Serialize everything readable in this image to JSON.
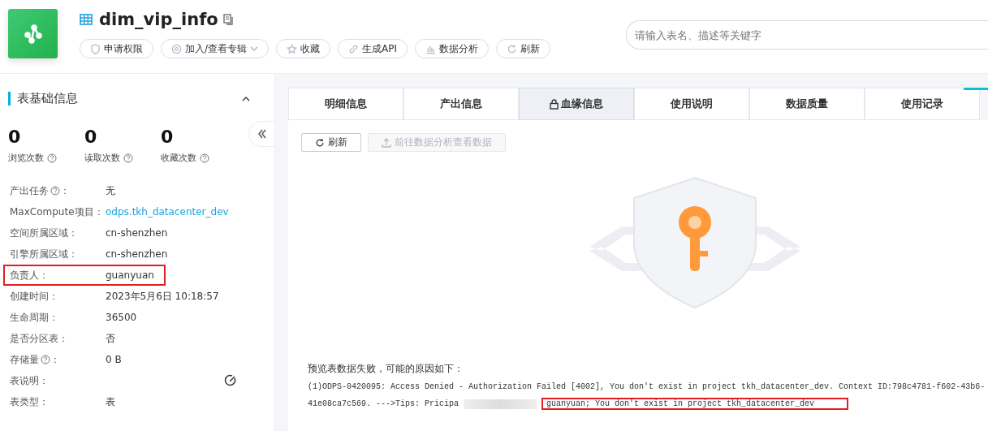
{
  "header": {
    "title": "dim_vip_info",
    "actions": [
      {
        "kind": "shield",
        "label": "申请权限",
        "caret": false
      },
      {
        "kind": "album",
        "label": "加入/查看专辑",
        "caret": true
      },
      {
        "kind": "star",
        "label": "收藏",
        "caret": false
      },
      {
        "kind": "link",
        "label": "生成API",
        "caret": false
      },
      {
        "kind": "chart",
        "label": "数据分析",
        "caret": false
      },
      {
        "kind": "refresh",
        "label": "刷新",
        "caret": false
      }
    ],
    "search": {
      "placeholder": "请输入表名、描述等关键字"
    }
  },
  "sidebar": {
    "title": "表基础信息",
    "colon": "：",
    "stats": [
      {
        "value": "0",
        "label": "浏览次数"
      },
      {
        "value": "0",
        "label": "读取次数"
      },
      {
        "value": "0",
        "label": "收藏次数"
      }
    ],
    "fields": [
      {
        "label": "产出任务",
        "help": true,
        "value": "无",
        "link": false,
        "highlighted": false
      },
      {
        "label": "MaxCompute项目",
        "help": false,
        "value": "odps.tkh_datacenter_dev",
        "link": true,
        "highlighted": false
      },
      {
        "label": "空间所属区域",
        "help": false,
        "value": "cn-shenzhen",
        "link": false,
        "highlighted": false
      },
      {
        "label": "引擎所属区域",
        "help": false,
        "value": "cn-shenzhen",
        "link": false,
        "highlighted": false
      },
      {
        "label": "负责人",
        "help": false,
        "value": "guanyuan",
        "link": false,
        "highlighted": true
      },
      {
        "label": "创建时间",
        "help": false,
        "value": "2023年5月6日 10:18:57",
        "link": false,
        "highlighted": false
      },
      {
        "label": "生命周期",
        "help": false,
        "value": "36500",
        "link": false,
        "highlighted": false
      },
      {
        "label": "是否分区表",
        "help": false,
        "value": "否",
        "link": false,
        "highlighted": false
      },
      {
        "label": "存储量",
        "help": true,
        "value": "0 B",
        "link": false,
        "highlighted": false
      },
      {
        "label": "表说明",
        "help": false,
        "highlighted": false
      },
      {
        "label": "表类型",
        "help": false,
        "value": "表",
        "link": false,
        "highlighted": false
      }
    ]
  },
  "tabs": [
    {
      "label": "明细信息",
      "selected": false,
      "locked": false
    },
    {
      "label": "产出信息",
      "selected": false,
      "locked": false
    },
    {
      "label": "血缘信息",
      "selected": true,
      "locked": true
    },
    {
      "label": "使用说明",
      "selected": false,
      "locked": false
    },
    {
      "label": "数据质量",
      "selected": false,
      "locked": false
    },
    {
      "label": "使用记录",
      "selected": false,
      "locked": false
    }
  ],
  "toolbar": {
    "refresh": "刷新",
    "analyze": {
      "label": "前往数据分析查看数据",
      "disabled": true
    }
  },
  "error": {
    "title": "预览表数据失败，可能的原因如下：",
    "line1": "(1)ODPS-0420095: Access Denied - Authorization Failed [4002], You don't exist in project tkh_datacenter_dev. Context ID:798c4781-f602-43b6-",
    "line2_start": "41e08ca7c569. --->Tips: Pricipa",
    "line2_end": "guanyuan; You don't exist in project tkh_datacenter_dev"
  }
}
